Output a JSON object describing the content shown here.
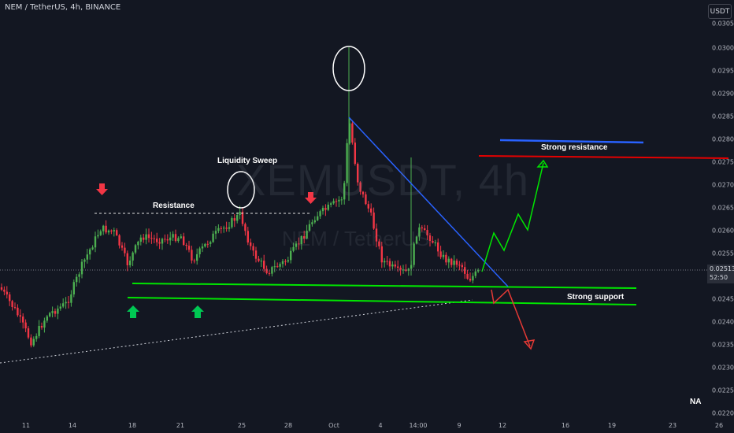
{
  "header": {
    "symbol_line": "NEM / TetherUS, 4h, BINANCE"
  },
  "currency_button": "USDT",
  "watermark": {
    "main": "XEMUSDT, 4h",
    "sub": "NEM / TetherUS"
  },
  "na_label": "NA",
  "price_axis": {
    "ticks": [
      "0.03050",
      "0.03000",
      "0.02950",
      "0.02900",
      "0.02850",
      "0.02800",
      "0.02750",
      "0.02700",
      "0.02650",
      "0.02600",
      "0.02550",
      "0.02500",
      "0.02450",
      "0.02400",
      "0.02350",
      "0.02300",
      "0.02250",
      "0.02200"
    ],
    "current_price": "0.02513",
    "countdown": "52:50"
  },
  "time_axis": {
    "ticks": [
      "11",
      "14",
      "18",
      "21",
      "25",
      "28",
      "Oct",
      "4",
      "14:00",
      "9",
      "12",
      "16",
      "19",
      "23",
      "26"
    ]
  },
  "annotations": {
    "resistance": "Resistance",
    "liquidity_sweep": "Liquidity Sweep",
    "strong_resistance": "Strong resistance",
    "strong_support": "Strong support"
  },
  "colors": {
    "background": "#131722",
    "bull": "#4caf50",
    "bear": "#f23645",
    "green_line": "#00e600",
    "red_line": "#e60000",
    "blue_line": "#2962ff",
    "arrow_green": "#00c853",
    "arrow_red": "#e53935"
  },
  "chart_data": {
    "type": "candlestick",
    "ylim": [
      0.022,
      0.0305
    ],
    "levels": {
      "resistance": 0.02635,
      "strong_resistance": 0.02765,
      "support_upper": 0.02482,
      "support_lower": 0.02465
    },
    "last_price": 0.02513,
    "indicated_path_up": [
      0.02513,
      0.0259,
      0.0263,
      0.0261,
      0.02755
    ],
    "indicated_path_down": [
      0.0249,
      0.0246,
      0.0234
    ]
  }
}
